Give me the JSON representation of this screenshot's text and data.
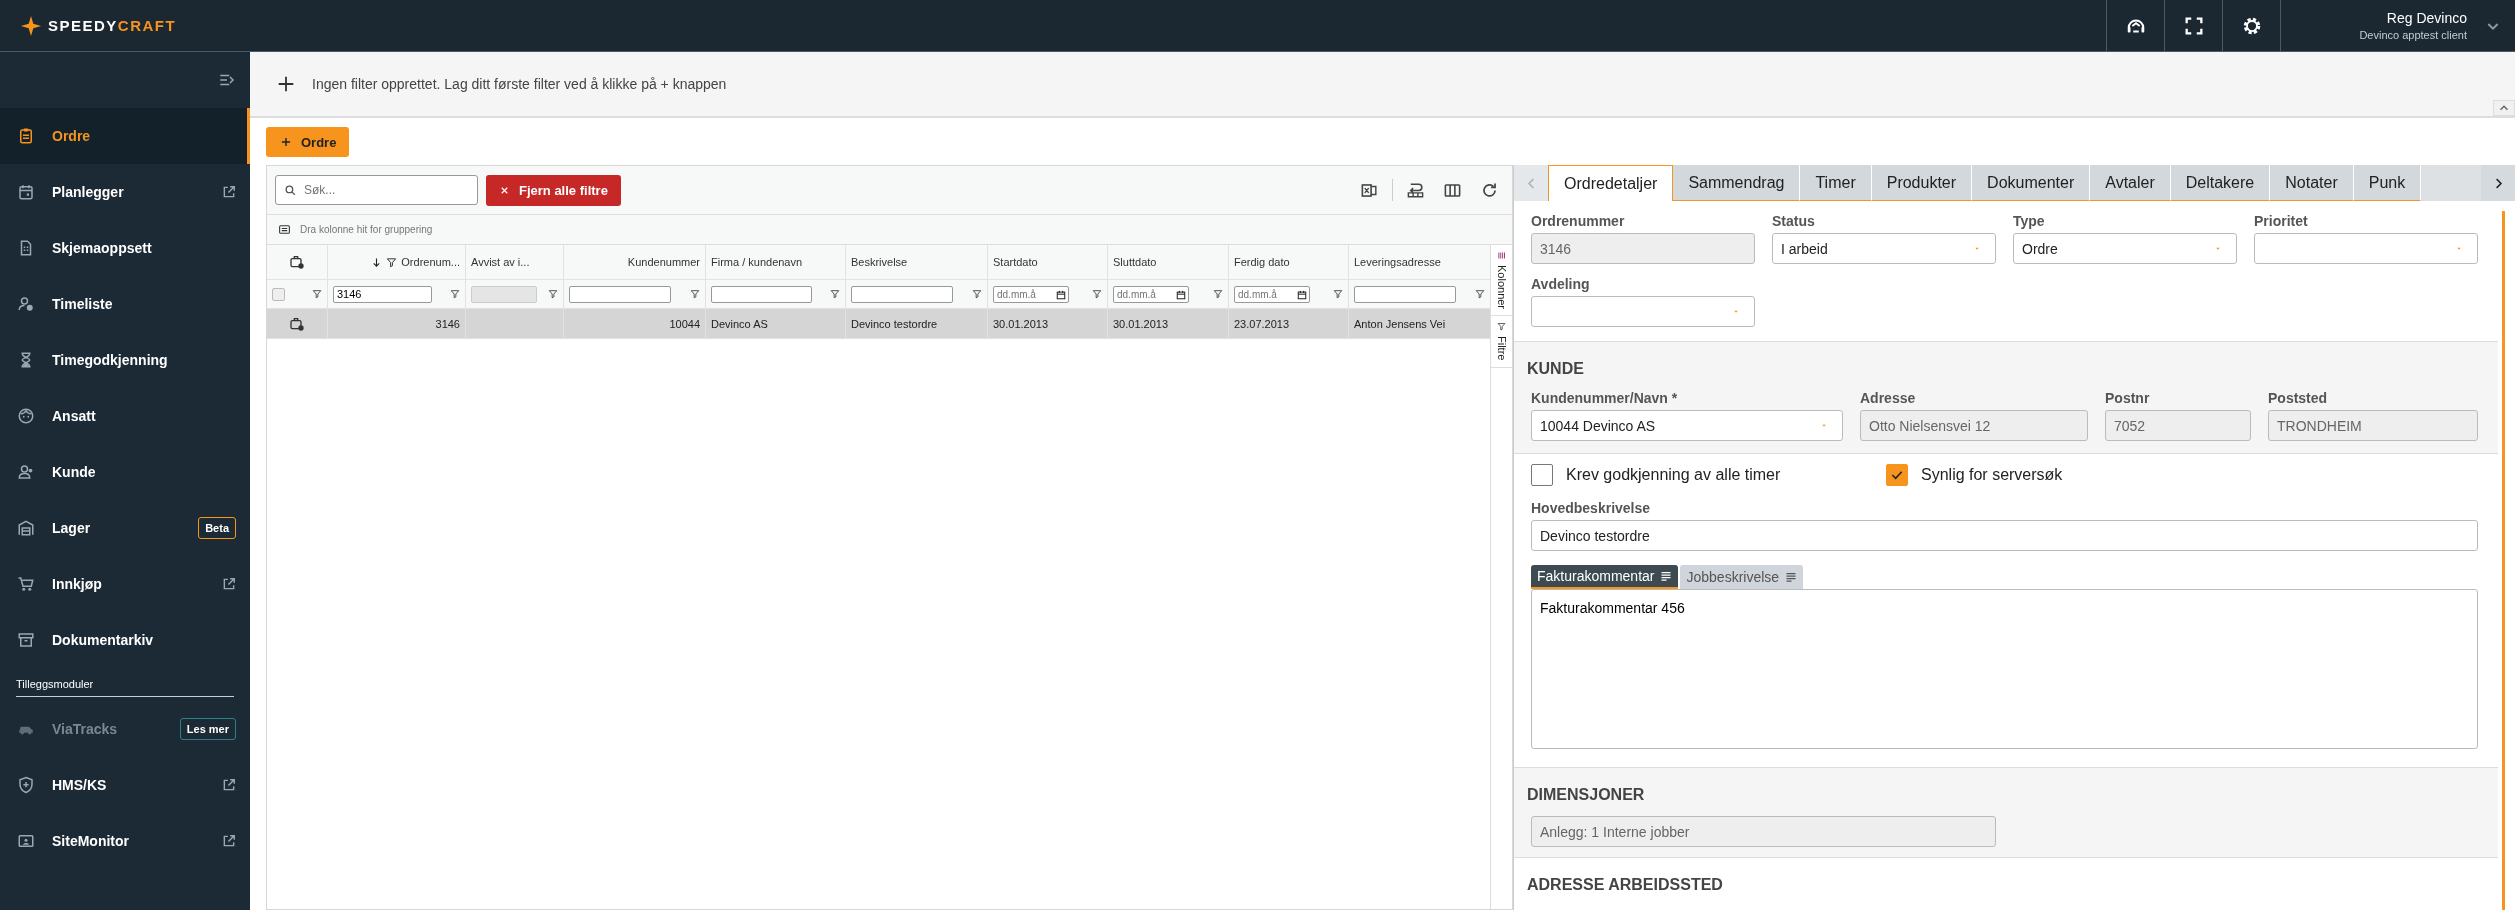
{
  "header": {
    "logo_first": "SPEEDY",
    "logo_second": "CRAFT",
    "user_name": "Reg Devinco",
    "user_client": "Devinco apptest client"
  },
  "sidebar": {
    "items": [
      {
        "label": "Ordre",
        "selected": true,
        "external": false
      },
      {
        "label": "Planlegger",
        "selected": false,
        "external": true
      },
      {
        "label": "Skjemaoppsett",
        "selected": false,
        "external": false
      },
      {
        "label": "Timeliste",
        "selected": false,
        "external": false
      },
      {
        "label": "Timegodkjenning",
        "selected": false,
        "external": false
      },
      {
        "label": "Ansatt",
        "selected": false,
        "external": false
      },
      {
        "label": "Kunde",
        "selected": false,
        "external": false
      },
      {
        "label": "Lager",
        "selected": false,
        "external": false,
        "badge": {
          "text": "Beta",
          "kind": "beta"
        }
      },
      {
        "label": "Innkjøp",
        "selected": false,
        "external": true
      },
      {
        "label": "Dokumentarkiv",
        "selected": false,
        "external": false
      }
    ],
    "section_label": "Tilleggsmoduler",
    "modules": [
      {
        "label": "ViaTracks",
        "disabled": true,
        "external": false,
        "badge": {
          "text": "Les mer",
          "kind": "promo"
        }
      },
      {
        "label": "HMS/KS",
        "disabled": false,
        "external": true
      },
      {
        "label": "SiteMonitor",
        "disabled": false,
        "external": true
      }
    ]
  },
  "filter_bar": {
    "message": "Ingen filter opprettet. Lag ditt første filter ved å klikke på + knappen"
  },
  "new_button": "Ordre",
  "grid": {
    "search": {
      "placeholder": "Søk..."
    },
    "clear_button": "Fjern alle filtre",
    "group_hint": "Dra kolonne hit for gruppering",
    "columns": [
      {
        "label": "Ordrenum...",
        "kind": "numeric",
        "sorted": true,
        "filter": {
          "kind": "text",
          "value": "3146"
        }
      },
      {
        "label": "Avvist av i...",
        "kind": "text",
        "sorted": false,
        "filter": {
          "kind": "disabled"
        }
      },
      {
        "label": "Kundenummer",
        "kind": "numeric",
        "sorted": false,
        "filter": {
          "kind": "text"
        }
      },
      {
        "label": "Firma / kundenavn",
        "kind": "text",
        "sorted": false,
        "filter": {
          "kind": "text"
        }
      },
      {
        "label": "Beskrivelse",
        "kind": "text",
        "sorted": false,
        "filter": {
          "kind": "text"
        }
      },
      {
        "label": "Startdato",
        "kind": "text",
        "sorted": false,
        "filter": {
          "kind": "date",
          "placeholder": "dd.mm.å"
        }
      },
      {
        "label": "Sluttdato",
        "kind": "text",
        "sorted": false,
        "filter": {
          "kind": "date",
          "placeholder": "dd.mm.å"
        }
      },
      {
        "label": "Ferdig dato",
        "kind": "text",
        "sorted": false,
        "filter": {
          "kind": "date",
          "placeholder": "dd.mm.å"
        }
      },
      {
        "label": "Leveringsadresse",
        "kind": "text",
        "sorted": false,
        "filter": {
          "kind": "text"
        }
      }
    ],
    "select_all": {
      "checked": false
    },
    "rows": [
      {
        "selected": true,
        "cells": [
          "3146",
          null,
          "10044",
          "Devinco AS",
          "Devinco testordre",
          "30.01.2013",
          "30.01.2013",
          "23.07.2013",
          "Anton Jensens Vei"
        ]
      }
    ],
    "side_tabs": [
      "Kolonner",
      "Filtre"
    ]
  },
  "detail": {
    "tab_prev": {
      "disabled": true
    },
    "tab_next": {
      "disabled": false
    },
    "tabs": [
      {
        "label": "Ordredetaljer",
        "selected": true
      },
      {
        "label": "Sammendrag",
        "selected": false
      },
      {
        "label": "Timer",
        "selected": false
      },
      {
        "label": "Produkter",
        "selected": false
      },
      {
        "label": "Dokumenter",
        "selected": false
      },
      {
        "label": "Avtaler",
        "selected": false
      },
      {
        "label": "Deltakere",
        "selected": false
      },
      {
        "label": "Notater",
        "selected": false
      },
      {
        "label": "Punk",
        "selected": false
      }
    ],
    "fields": [
      {
        "label": "Ordrenummer",
        "kind": "readonly",
        "value": "3146"
      },
      {
        "label": "Status",
        "kind": "select",
        "value": "I arbeid"
      },
      {
        "label": "Type",
        "kind": "select",
        "value": "Ordre"
      },
      {
        "label": "Prioritet",
        "kind": "select"
      },
      {
        "label": "Avdeling",
        "kind": "select"
      }
    ],
    "customer": {
      "heading": "KUNDE",
      "fields": [
        {
          "label": "Kundenummer/Navn *",
          "kind": "select",
          "value": "10044 Devinco AS"
        },
        {
          "label": "Adresse",
          "kind": "readonly",
          "value": "Otto Nielsensvei 12"
        },
        {
          "label": "Postnr",
          "kind": "readonly",
          "value": "7052"
        },
        {
          "label": "Poststed",
          "kind": "readonly",
          "value": "TRONDHEIM"
        }
      ]
    },
    "checkboxes": [
      {
        "label": "Krev godkjenning av alle timer",
        "checked": false
      },
      {
        "label": "Synlig for serversøk",
        "checked": true
      }
    ],
    "main_description": {
      "label": "Hovedbeskrivelse",
      "value": "Devinco testordre"
    },
    "text_tabs": [
      {
        "label": "Fakturakommentar",
        "selected": true
      },
      {
        "label": "Jobbeskrivelse",
        "selected": false
      }
    ],
    "comment": "Fakturakommentar 456",
    "dimensions": {
      "heading": "DIMENSJONER",
      "value": "Anlegg: 1 Interne jobber"
    },
    "work_address": {
      "heading": "ADRESSE ARBEIDSSTED"
    }
  }
}
